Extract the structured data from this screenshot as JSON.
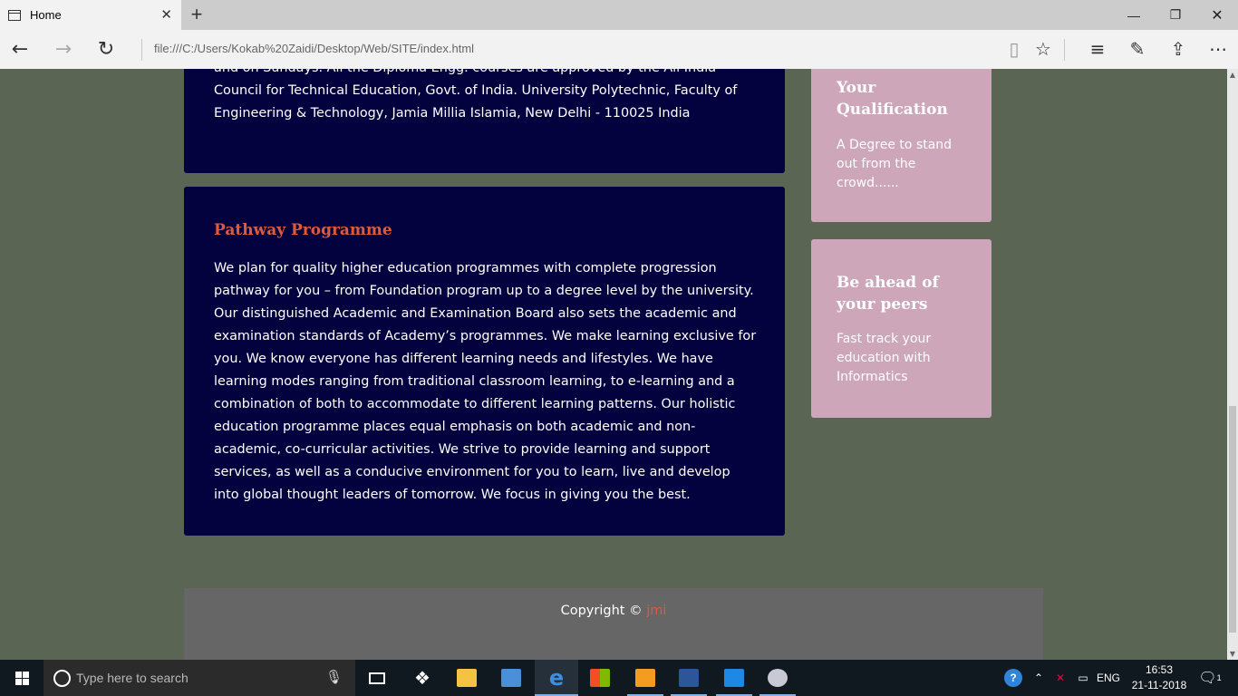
{
  "browser": {
    "tab_title": "Home",
    "new_tab": "+",
    "url": "file:///C:/Users/Kokab%20Zaidi/Desktop/Web/SITE/index.html",
    "window_buttons": [
      "minimize",
      "restore",
      "close"
    ]
  },
  "page": {
    "intro_text": "and on Sundays. All the Diploma Engg. courses are approved by the All India Council for Technical Education, Govt. of India. University Polytechnic, Faculty of Engineering & Technology, Jamia Millia Islamia, New Delhi - 110025 India",
    "pathway": {
      "title": "Pathway Programme",
      "body": "We plan for quality higher education programmes with complete progression pathway for you – from Foundation program up to a degree level by the university. Our distinguished Academic and Examination Board also sets the academic and examination standards of Academy’s programmes. We make learning exclusive for you. We know everyone has different learning needs and lifestyles. We have learning modes ranging from traditional classroom learning, to e-learning and a combination of both to accommodate to different learning patterns. Our holistic education programme places equal emphasis on both academic and non-academic, co-curricular activities. We strive to provide learning and support services, as well as a conducive environment for you to learn, live and develop into global thought leaders of tomorrow. We focus in giving you the best."
    },
    "sidebar": [
      {
        "title": "Your Qualification",
        "text": "A Degree to stand out from the crowd......"
      },
      {
        "title": "Be ahead of your peers",
        "text": "Fast track your education with Informatics"
      }
    ],
    "footer": {
      "copyright": "Copyright ©",
      "link": "jmi"
    }
  },
  "taskbar": {
    "search_placeholder": "Type here to search",
    "language": "ENG",
    "time": "16:53",
    "date": "21-11-2018",
    "notification_count": "1"
  },
  "colors": {
    "page_bg": "#5b6553",
    "box_bg": "#03013e",
    "accent": "#de5a3c",
    "sidebar_bg": "#cda7b9",
    "footer_bg": "#666666"
  }
}
